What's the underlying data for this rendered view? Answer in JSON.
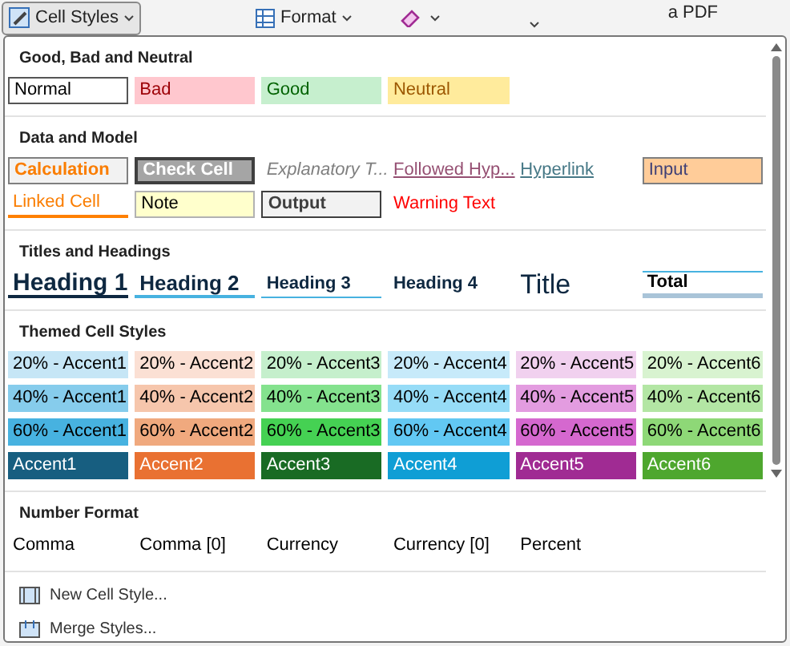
{
  "ribbon": {
    "cell_styles_button": "Cell Styles",
    "format_button": "Format",
    "pdf_label": "a PDF"
  },
  "sections": [
    {
      "title": "Good, Bad and Neutral",
      "items": [
        {
          "label": "Normal",
          "kind": "normal"
        },
        {
          "label": "Bad",
          "kind": "bad"
        },
        {
          "label": "Good",
          "kind": "good"
        },
        {
          "label": "Neutral",
          "kind": "neutral"
        }
      ]
    },
    {
      "title": "Data and Model",
      "items": [
        {
          "label": "Calculation",
          "kind": "calculation"
        },
        {
          "label": "Check Cell",
          "kind": "check"
        },
        {
          "label": "Explanatory T...",
          "kind": "explanatory"
        },
        {
          "label": "Followed Hyp...",
          "kind": "followed"
        },
        {
          "label": "Hyperlink",
          "kind": "hyperlink"
        },
        {
          "label": "Input",
          "kind": "input"
        },
        {
          "label": "Linked Cell",
          "kind": "linked"
        },
        {
          "label": "Note",
          "kind": "note"
        },
        {
          "label": "Output",
          "kind": "output"
        },
        {
          "label": "Warning Text",
          "kind": "warning"
        }
      ]
    },
    {
      "title": "Titles and Headings",
      "items": [
        {
          "label": "Heading 1",
          "kind": "h1"
        },
        {
          "label": "Heading 2",
          "kind": "h2"
        },
        {
          "label": "Heading 3",
          "kind": "h3"
        },
        {
          "label": "Heading 4",
          "kind": "h4"
        },
        {
          "label": "Title",
          "kind": "title"
        },
        {
          "label": "Total",
          "kind": "total"
        }
      ]
    },
    {
      "title": "Themed Cell Styles",
      "items": [
        {
          "label": "20% - Accent1",
          "kind": "tint",
          "color": "#c6e6f6"
        },
        {
          "label": "20% - Accent2",
          "kind": "tint",
          "color": "#fbe0d4"
        },
        {
          "label": "20% - Accent3",
          "kind": "tint",
          "color": "#c5efcc"
        },
        {
          "label": "20% - Accent4",
          "kind": "tint",
          "color": "#c7eafa"
        },
        {
          "label": "20% - Accent5",
          "kind": "tint",
          "color": "#f1d1ef"
        },
        {
          "label": "20% - Accent6",
          "kind": "tint",
          "color": "#d8f3d0"
        },
        {
          "label": "40% - Accent1",
          "kind": "tint",
          "color": "#86ccec"
        },
        {
          "label": "40% - Accent2",
          "kind": "tint",
          "color": "#f6c6ac"
        },
        {
          "label": "40% - Accent3",
          "kind": "tint",
          "color": "#84e28e"
        },
        {
          "label": "40% - Accent4",
          "kind": "tint",
          "color": "#96dcf7"
        },
        {
          "label": "40% - Accent5",
          "kind": "tint",
          "color": "#e39ce0"
        },
        {
          "label": "40% - Accent6",
          "kind": "tint",
          "color": "#b3e6a4"
        },
        {
          "label": "60% - Accent1",
          "kind": "tint",
          "color": "#47b2e0"
        },
        {
          "label": "60% - Accent2",
          "kind": "tint",
          "color": "#f0a97e"
        },
        {
          "label": "60% - Accent3",
          "kind": "tint",
          "color": "#45d153"
        },
        {
          "label": "60% - Accent4",
          "kind": "tint",
          "color": "#62c8f3"
        },
        {
          "label": "60% - Accent5",
          "kind": "tint",
          "color": "#d568cf"
        },
        {
          "label": "60% - Accent6",
          "kind": "tint",
          "color": "#8ed877"
        },
        {
          "label": "Accent1",
          "kind": "accent",
          "color": "#175e80"
        },
        {
          "label": "Accent2",
          "kind": "accent",
          "color": "#e97132"
        },
        {
          "label": "Accent3",
          "kind": "accent",
          "color": "#196b24"
        },
        {
          "label": "Accent4",
          "kind": "accent",
          "color": "#0f9ed5"
        },
        {
          "label": "Accent5",
          "kind": "accent",
          "color": "#a02b93"
        },
        {
          "label": "Accent6",
          "kind": "accent",
          "color": "#4ea72e"
        }
      ]
    },
    {
      "title": "Number Format",
      "items": [
        {
          "label": "Comma",
          "kind": "plain"
        },
        {
          "label": "Comma [0]",
          "kind": "plain"
        },
        {
          "label": "Currency",
          "kind": "plain"
        },
        {
          "label": "Currency [0]",
          "kind": "plain"
        },
        {
          "label": "Percent",
          "kind": "plain"
        }
      ]
    }
  ],
  "menu": [
    {
      "label": "New Cell Style...",
      "kind": "new"
    },
    {
      "label": "Merge Styles...",
      "kind": "merge"
    }
  ]
}
